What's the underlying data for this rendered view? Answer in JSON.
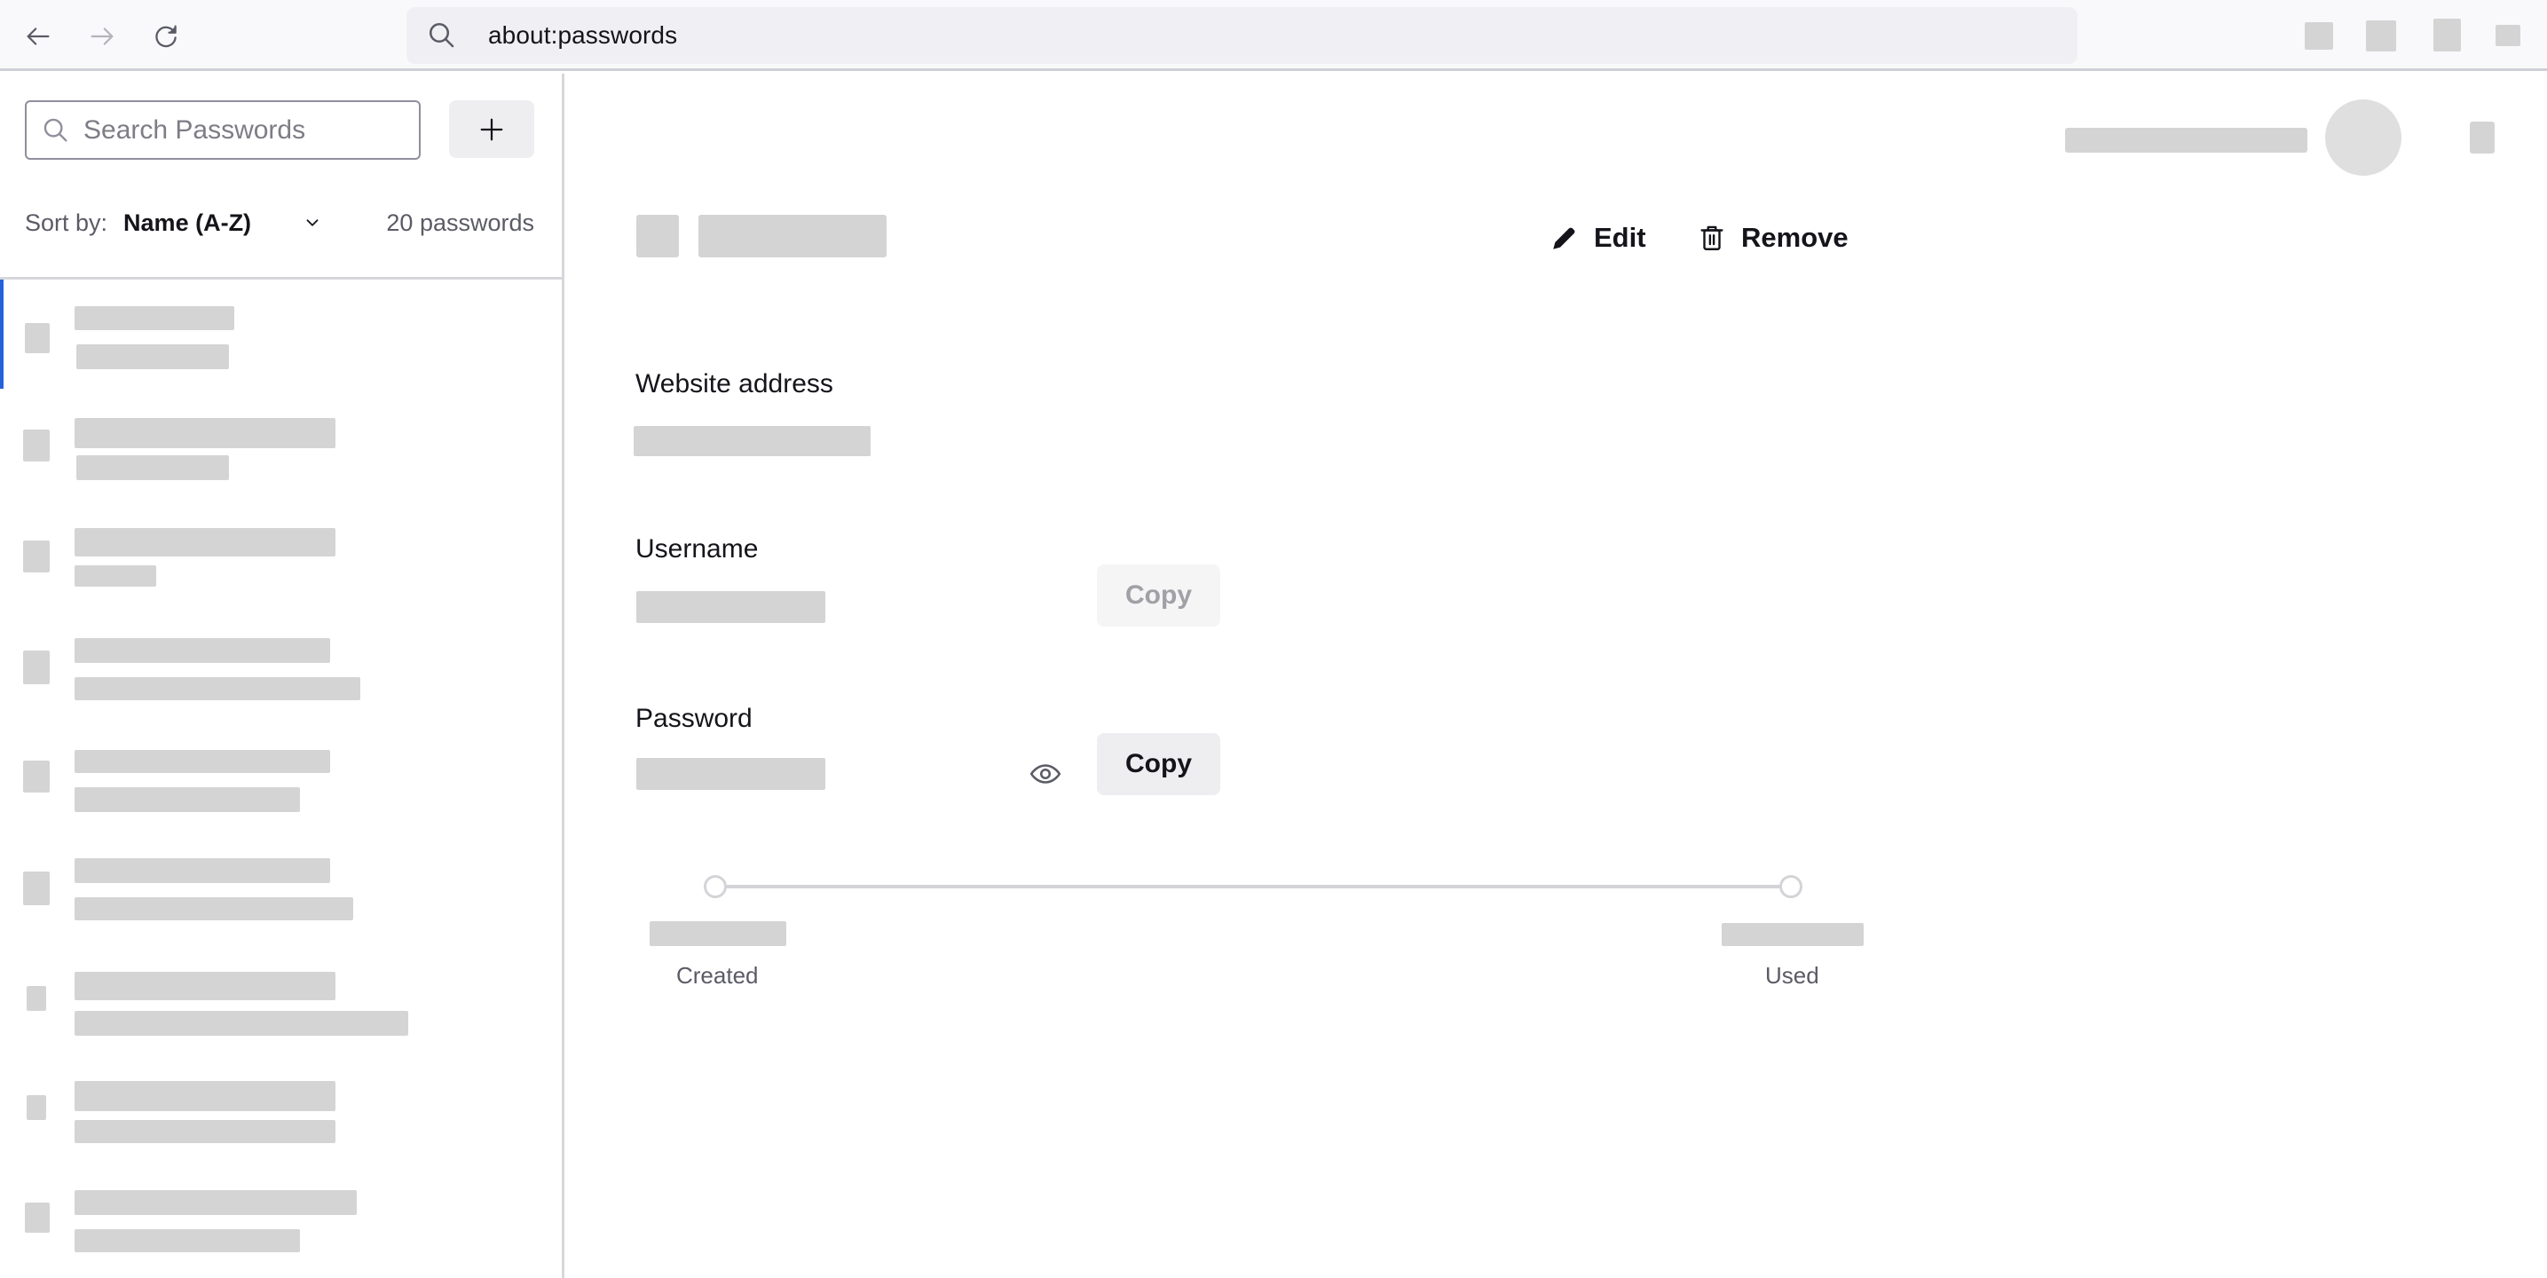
{
  "toolbar": {
    "back_icon": "arrow-left-icon",
    "forward_icon": "arrow-right-icon",
    "reload_icon": "reload-icon",
    "url_icon": "search-icon",
    "url": "about:passwords"
  },
  "sidebar": {
    "search": {
      "placeholder": "Search Passwords",
      "value": ""
    },
    "add_button_icon": "plus-icon",
    "sort_label": "Sort by:",
    "sort_value": "Name (A-Z)",
    "count": "20 passwords",
    "items_visible": 9,
    "selected_index": 0
  },
  "detail": {
    "edit_label": "Edit",
    "remove_label": "Remove",
    "website_label": "Website address",
    "username_label": "Username",
    "password_label": "Password",
    "username_copy_label": "Copy",
    "password_copy_label": "Copy",
    "reveal_icon": "eye-icon",
    "timeline": {
      "created_label": "Created",
      "used_label": "Used"
    }
  },
  "colors": {
    "accent": "#2662d9",
    "skeleton": "#d4d4d4",
    "toolbar_bg": "#f9f9fb",
    "urlbar_bg": "#f0f0f4"
  }
}
